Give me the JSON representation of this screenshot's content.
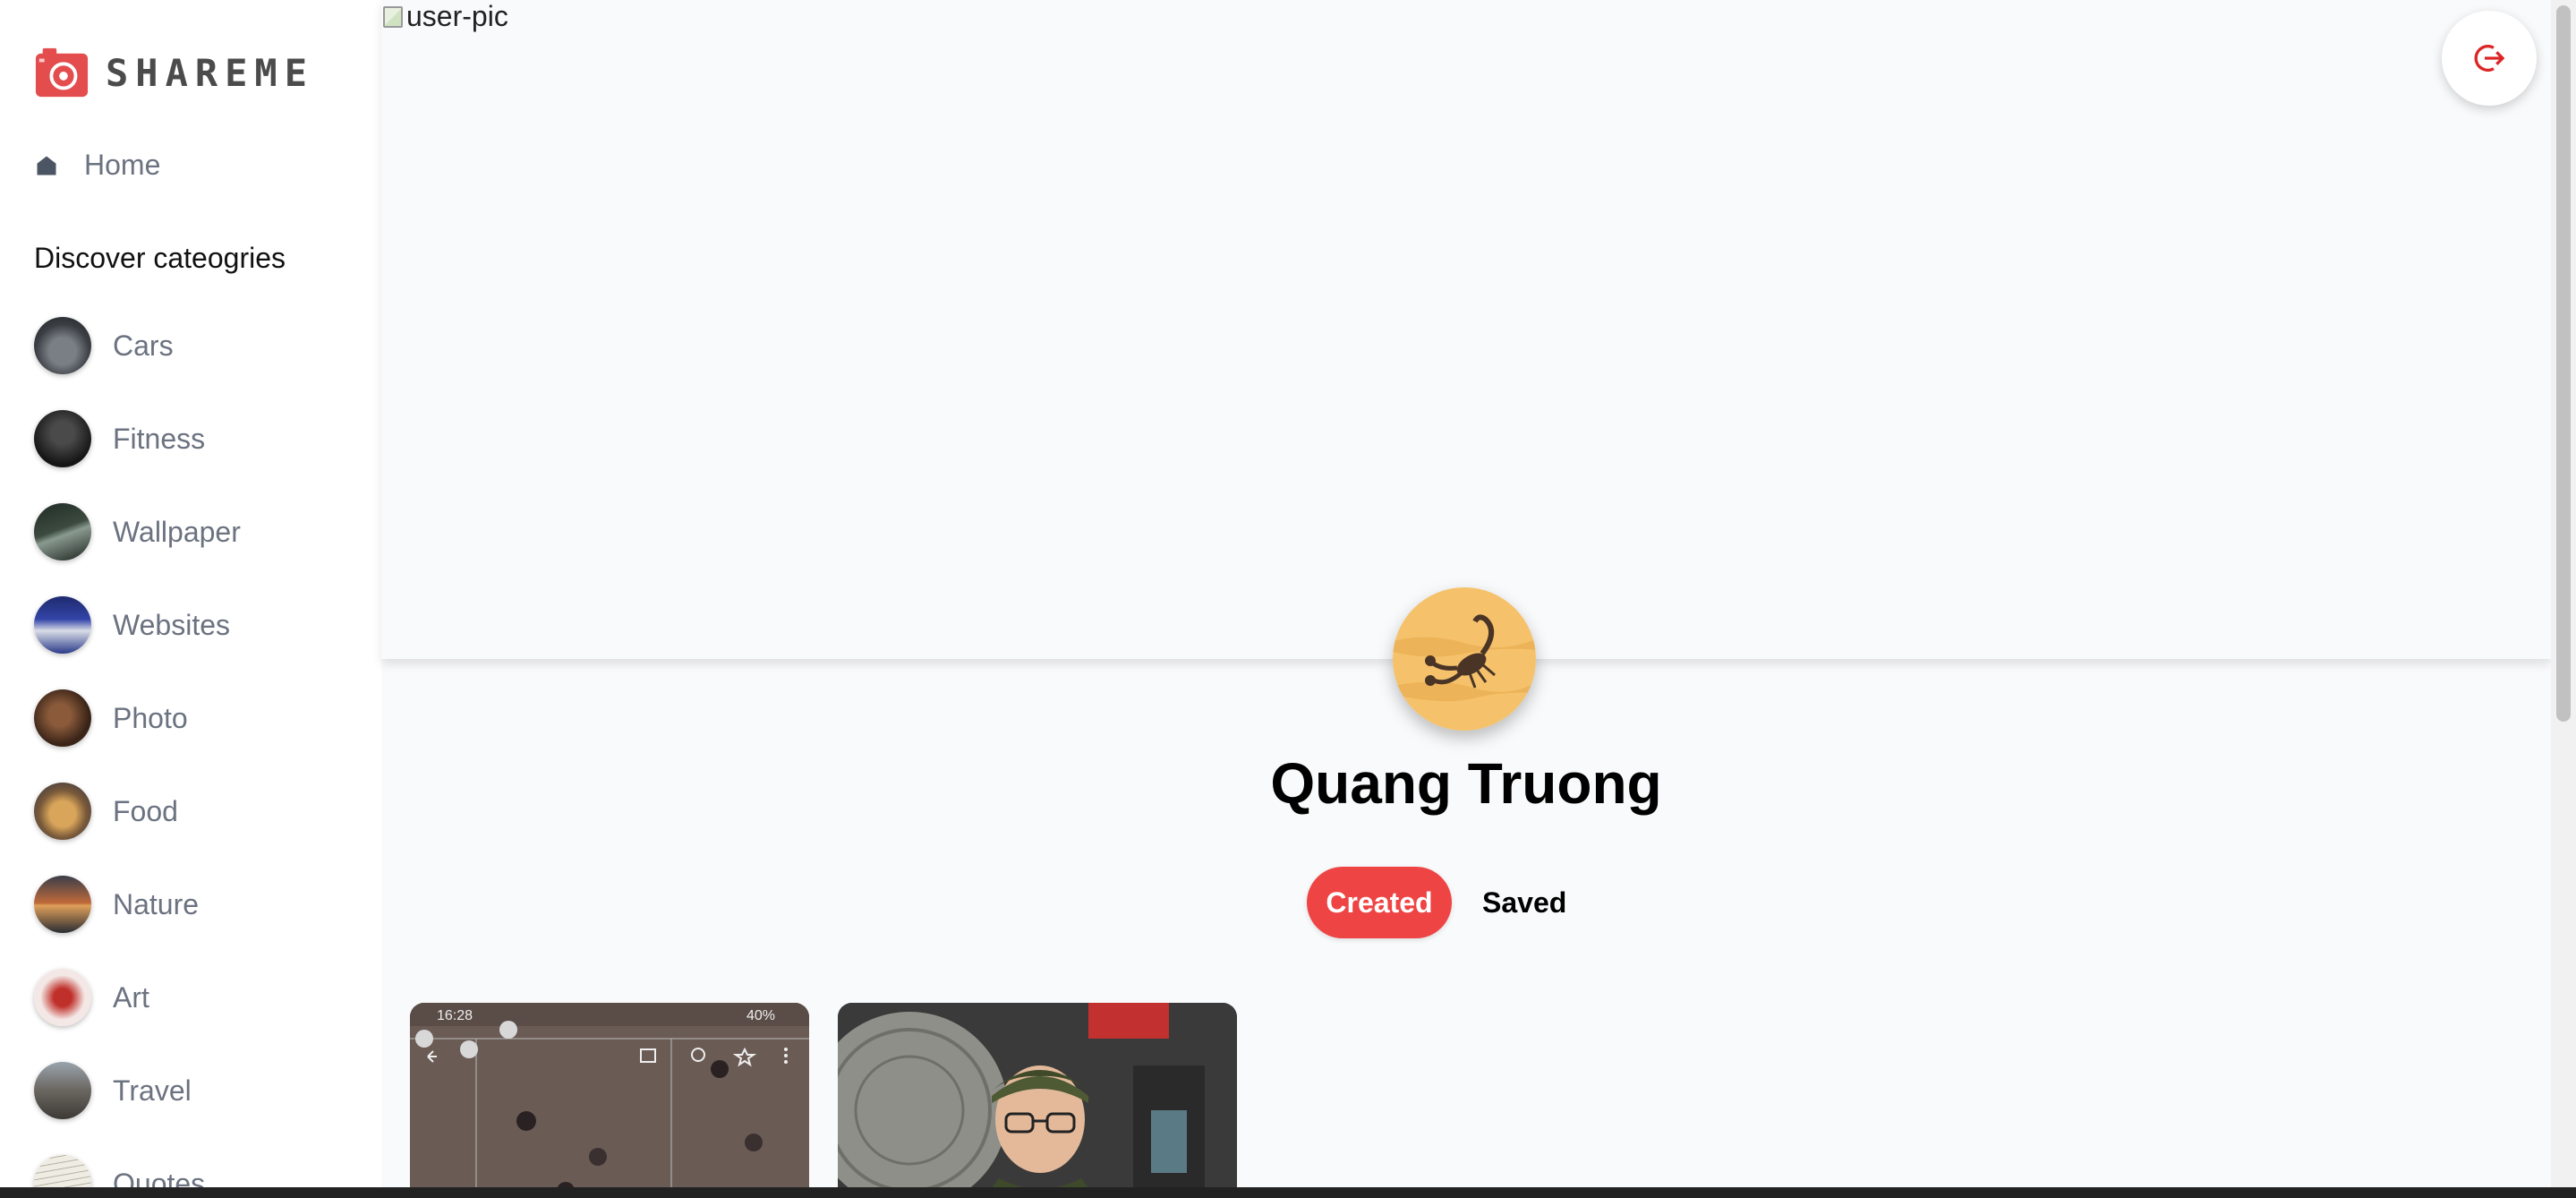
{
  "brand": {
    "name": "SHAREME",
    "accent": "#ef4444"
  },
  "sidebar": {
    "home_label": "Home",
    "discover_heading": "Discover cateogries",
    "categories": [
      {
        "label": "Cars"
      },
      {
        "label": "Fitness"
      },
      {
        "label": "Wallpaper"
      },
      {
        "label": "Websites"
      },
      {
        "label": "Photo"
      },
      {
        "label": "Food"
      },
      {
        "label": "Nature"
      },
      {
        "label": "Art"
      },
      {
        "label": "Travel"
      },
      {
        "label": "Quotes"
      }
    ]
  },
  "profile": {
    "banner_alt": "user-pic",
    "name": "Quang Truong",
    "tabs": {
      "created": "Created",
      "saved": "Saved"
    },
    "active_tab": "created"
  },
  "pins": [
    {
      "time": "16:28",
      "status": "40%"
    },
    {}
  ],
  "icons": {
    "logout": "logout-icon",
    "home": "home-icon",
    "logo": "camera-icon"
  }
}
